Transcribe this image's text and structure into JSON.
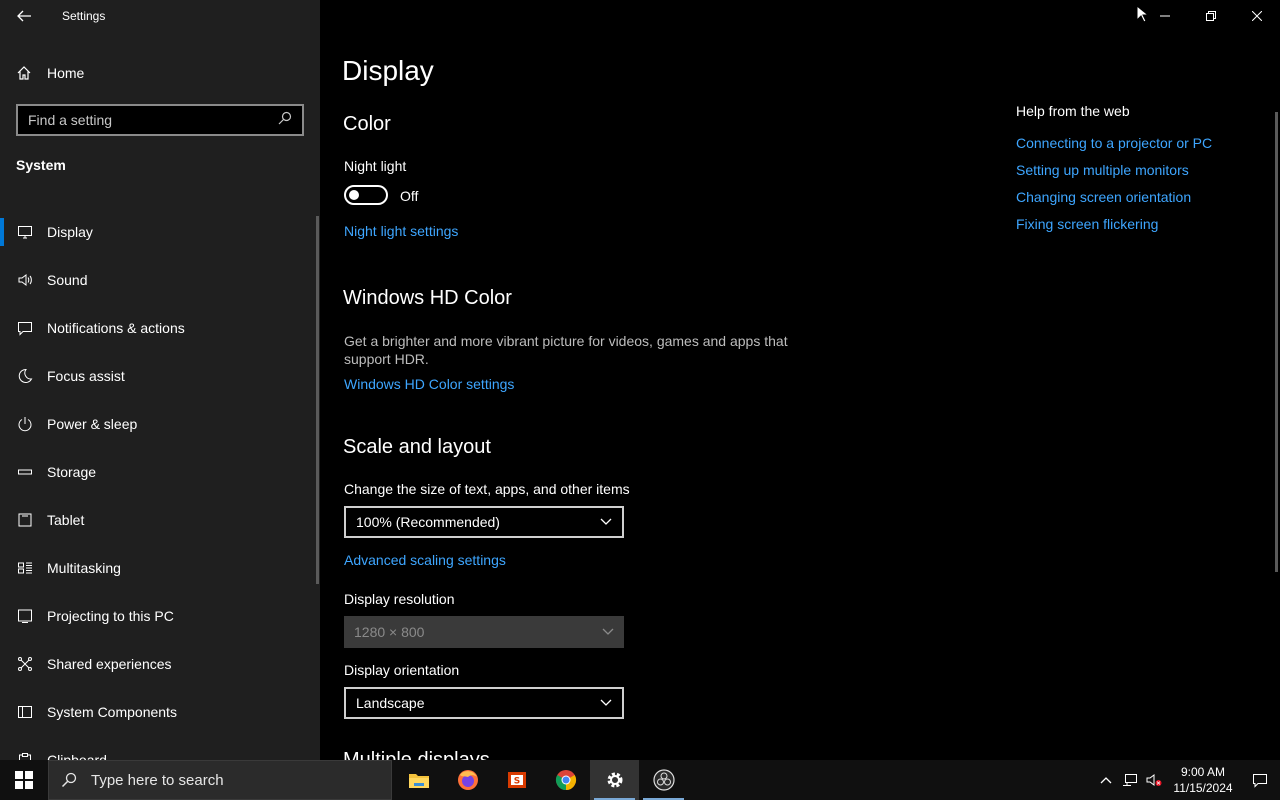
{
  "window": {
    "title": "Settings"
  },
  "sidebar": {
    "home_label": "Home",
    "search_placeholder": "Find a setting",
    "section": "System",
    "items": [
      {
        "label": "Display",
        "icon": "monitor-icon",
        "selected": true
      },
      {
        "label": "Sound",
        "icon": "speaker-icon"
      },
      {
        "label": "Notifications & actions",
        "icon": "message-icon"
      },
      {
        "label": "Focus assist",
        "icon": "moon-icon"
      },
      {
        "label": "Power & sleep",
        "icon": "power-icon"
      },
      {
        "label": "Storage",
        "icon": "storage-icon"
      },
      {
        "label": "Tablet",
        "icon": "tablet-icon"
      },
      {
        "label": "Multitasking",
        "icon": "multitasking-icon"
      },
      {
        "label": "Projecting to this PC",
        "icon": "projecting-icon"
      },
      {
        "label": "Shared experiences",
        "icon": "shared-icon"
      },
      {
        "label": "System Components",
        "icon": "components-icon"
      },
      {
        "label": "Clipboard",
        "icon": "clipboard-icon"
      }
    ]
  },
  "main": {
    "title": "Display",
    "color_heading": "Color",
    "night_light_label": "Night light",
    "night_light_state": "Off",
    "night_light_link": "Night light settings",
    "hd_heading": "Windows HD Color",
    "hd_desc": "Get a brighter and more vibrant picture for videos, games and apps that support HDR.",
    "hd_link": "Windows HD Color settings",
    "scale_heading": "Scale and layout",
    "scale_label": "Change the size of text, apps, and other items",
    "scale_value": "100% (Recommended)",
    "advanced_link": "Advanced scaling settings",
    "resolution_label": "Display resolution",
    "resolution_value": "1280 × 800",
    "orientation_label": "Display orientation",
    "orientation_value": "Landscape",
    "next_heading": "Multiple displays"
  },
  "help": {
    "title": "Help from the web",
    "links": [
      "Connecting to a projector or PC",
      "Setting up multiple monitors",
      "Changing screen orientation",
      "Fixing screen flickering"
    ]
  },
  "taskbar": {
    "search_placeholder": "Type here to search",
    "apps": [
      "file-explorer-icon",
      "firefox-icon",
      "office-icon",
      "chrome-icon",
      "settings-icon",
      "obs-icon"
    ],
    "time": "9:00 AM",
    "date": "11/15/2024"
  },
  "colors": {
    "accent": "#0078d7",
    "link": "#3ea6ff",
    "sidebar_bg": "#1f1f1f"
  }
}
